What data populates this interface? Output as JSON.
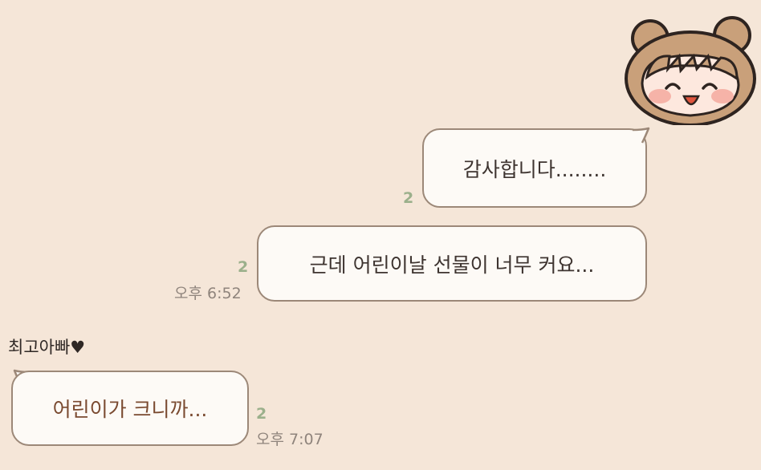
{
  "messages": {
    "m1": {
      "text": "감사합니다........",
      "unread": "2"
    },
    "m2": {
      "text": "근데 어린이날 선물이 너무 커요...",
      "unread": "2",
      "time": "오후 6:52"
    },
    "m3": {
      "sender": "최고아빠♥",
      "text": "어린이가 크니까...",
      "unread": "2",
      "time": "오후 7:07"
    }
  },
  "colors": {
    "background": "#f5e6d8",
    "bubble_fill": "#fdfaf6",
    "bubble_border": "#9c8878",
    "unread_count": "#9bb08b",
    "incoming_text": "#7a4a30"
  },
  "icons": [
    "bear-hood-avatar-icon"
  ]
}
